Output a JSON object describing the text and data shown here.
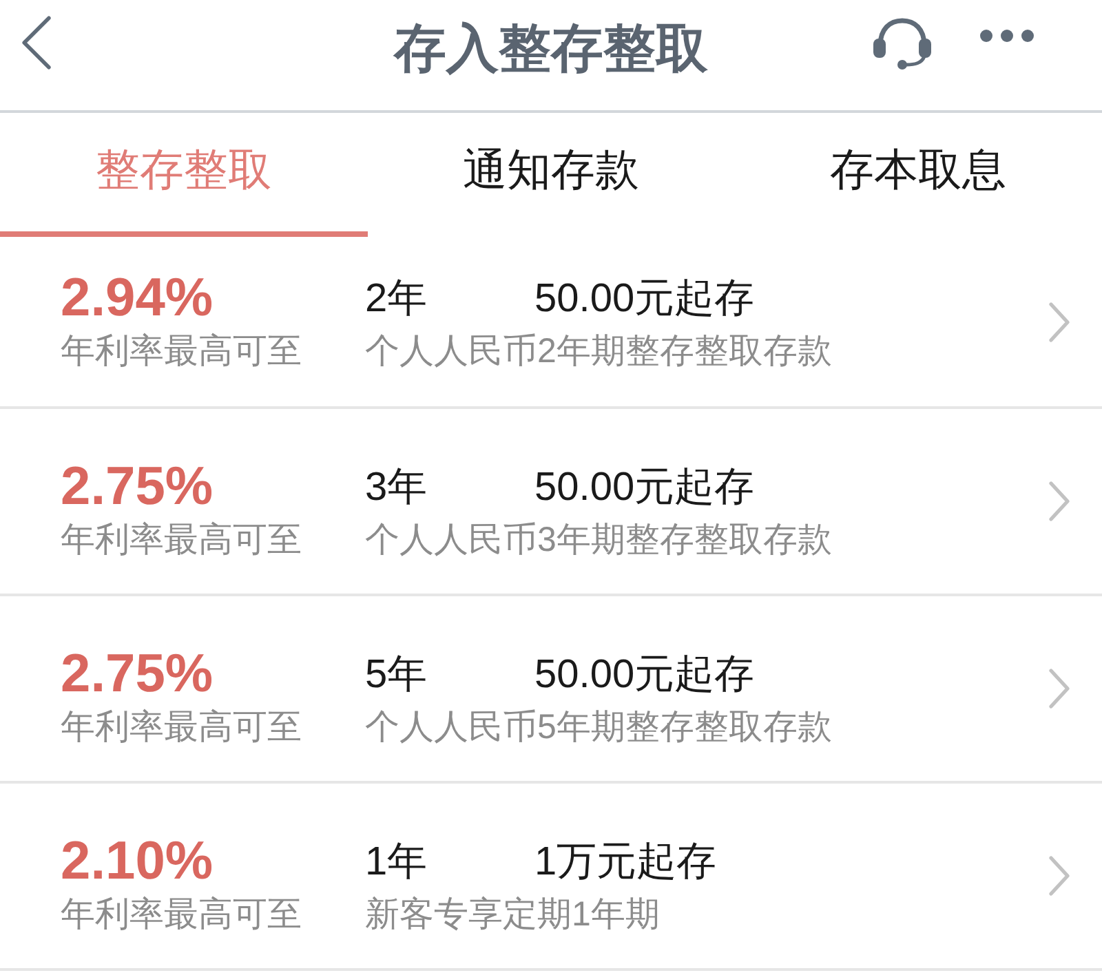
{
  "header": {
    "title": "存入整存整取"
  },
  "tabs": [
    {
      "label": "整存整取",
      "selected": true
    },
    {
      "label": "通知存款",
      "selected": false
    },
    {
      "label": "存本取息",
      "selected": false
    }
  ],
  "products": [
    {
      "rate": "2.94%",
      "rate_label": "年利率最高可至",
      "term": "2年",
      "min_amount": "50.00元起存",
      "description": "个人人民币2年期整存整取存款"
    },
    {
      "rate": "2.75%",
      "rate_label": "年利率最高可至",
      "term": "3年",
      "min_amount": "50.00元起存",
      "description": "个人人民币3年期整存整取存款"
    },
    {
      "rate": "2.75%",
      "rate_label": "年利率最高可至",
      "term": "5年",
      "min_amount": "50.00元起存",
      "description": "个人人民币5年期整存整取存款"
    },
    {
      "rate": "2.10%",
      "rate_label": "年利率最高可至",
      "term": "1年",
      "min_amount": "1万元起存",
      "description": "新客专享定期1年期"
    }
  ]
}
